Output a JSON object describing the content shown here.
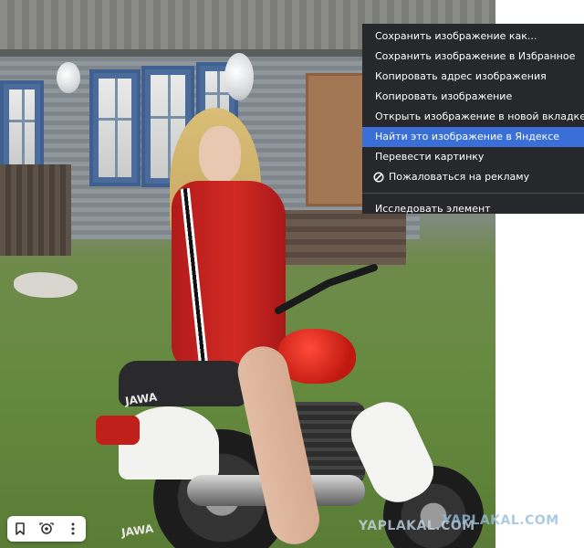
{
  "context_menu": {
    "items": [
      {
        "label": "Сохранить изображение как..."
      },
      {
        "label": "Сохранить изображение в Избранное"
      },
      {
        "label": "Копировать адрес изображения"
      },
      {
        "label": "Копировать изображение"
      },
      {
        "label": "Открыть изображение в новой вкладке"
      },
      {
        "label": "Найти это изображение в Яндексе",
        "highlighted": true
      },
      {
        "label": "Перевести картинку"
      },
      {
        "label": "Пожаловаться на рекламу",
        "icon": "block-icon"
      }
    ],
    "footer_item": {
      "label": "Исследовать элемент"
    },
    "colors": {
      "background": "#26282b",
      "highlight": "#3a6fd8",
      "text": "#ffffff"
    }
  },
  "toolbar": {
    "icons": [
      "bookmark-icon",
      "lens-search-icon",
      "more-vertical-icon"
    ]
  },
  "photo": {
    "brand_text_seat": "JAWA",
    "brand_text_tank": "JAWA",
    "watermark_1": "YAPLAKAL.COM",
    "watermark_2": "YAPLAKAL.COM"
  }
}
